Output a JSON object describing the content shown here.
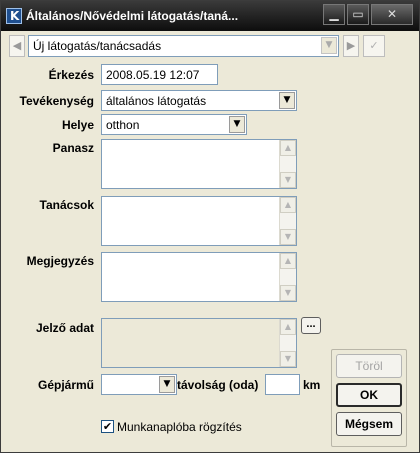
{
  "window": {
    "title": "Általános/Nővédelmi látogatás/taná...",
    "controls": {
      "minimize": "▁",
      "maximize": "▭",
      "close": "✕"
    }
  },
  "nav": {
    "prev_symbol": "◀",
    "record_combo": "Új látogatás/tanácsadás",
    "next_symbol": "▶",
    "confirm_symbol": "✓",
    "dropdown_symbol": "▼"
  },
  "form": {
    "erkezes": {
      "label": "Érkezés",
      "value": "2008.05.19 12:07"
    },
    "tevekenyseg": {
      "label": "Tevékenység",
      "value": "általános látogatás"
    },
    "helye": {
      "label": "Helye",
      "value": "otthon"
    },
    "panasz": {
      "label": "Panasz",
      "value": ""
    },
    "tanacsok": {
      "label": "Tanácsok",
      "value": ""
    },
    "megjegyzes": {
      "label": "Megjegyzés",
      "value": ""
    },
    "jelzo_adat": {
      "label": "Jelző adat",
      "value": "",
      "button_label": "..."
    },
    "gepjarmu": {
      "label": "Gépjármű",
      "value": ""
    },
    "tavolsag": {
      "label": "távolság (oda)",
      "value": "",
      "unit": "km"
    },
    "munkanaplo": {
      "label": "Munkanaplóba rögzítés",
      "checked": true,
      "check_symbol": "✔"
    }
  },
  "scroll_symbols": {
    "up": "▲",
    "down": "▼"
  },
  "buttons": {
    "delete": "Töröl",
    "ok": "OK",
    "cancel": "Mégsem"
  }
}
